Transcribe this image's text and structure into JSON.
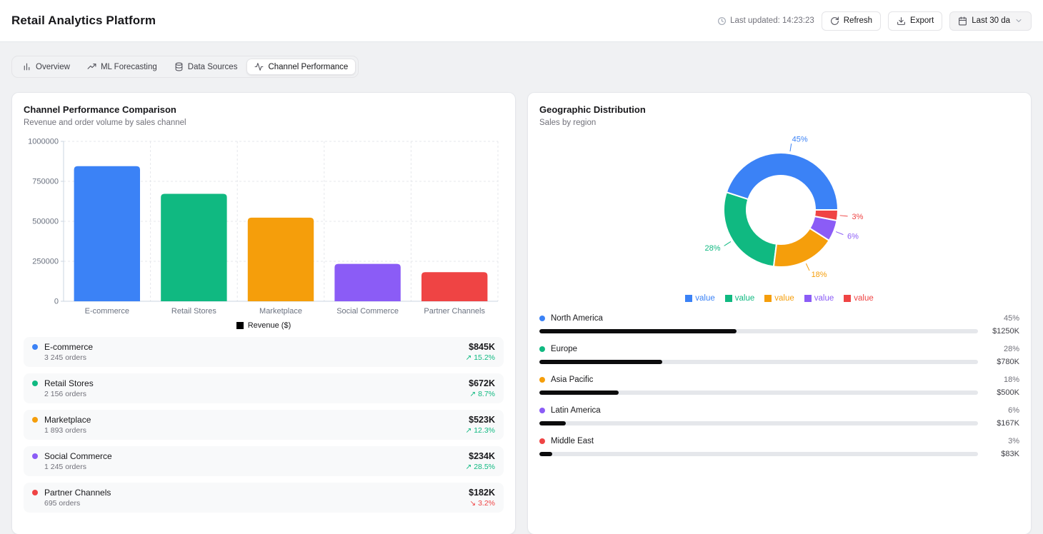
{
  "header": {
    "title": "Retail Analytics Platform",
    "last_updated": "Last updated: 14:23:23",
    "refresh_label": "Refresh",
    "export_label": "Export",
    "date_range_label": "Last 30 da",
    "icons": [
      "clock-icon",
      "refresh-icon",
      "download-icon",
      "calendar-icon",
      "chevron-down-icon"
    ]
  },
  "tabs": [
    {
      "label": "Overview",
      "icon": "bar-chart",
      "active": false
    },
    {
      "label": "ML Forecasting",
      "icon": "trending-up",
      "active": false
    },
    {
      "label": "Data Sources",
      "icon": "database",
      "active": false
    },
    {
      "label": "Channel Performance",
      "icon": "activity",
      "active": true
    }
  ],
  "channel_card": {
    "title": "Channel Performance Comparison",
    "subtitle": "Revenue and order volume by sales channel",
    "legend_label": "Revenue ($)",
    "legend_color": "#000000",
    "channels": [
      {
        "name": "E-commerce",
        "orders": "3 245 orders",
        "value": "$845K",
        "trend": "15.2%",
        "direction": "up",
        "color": "#3b82f6"
      },
      {
        "name": "Retail Stores",
        "orders": "2 156 orders",
        "value": "$672K",
        "trend": "8.7%",
        "direction": "up",
        "color": "#10b981"
      },
      {
        "name": "Marketplace",
        "orders": "1 893 orders",
        "value": "$523K",
        "trend": "12.3%",
        "direction": "up",
        "color": "#f59e0b"
      },
      {
        "name": "Social Commerce",
        "orders": "1 245 orders",
        "value": "$234K",
        "trend": "28.5%",
        "direction": "up",
        "color": "#8b5cf6"
      },
      {
        "name": "Partner Channels",
        "orders": "695 orders",
        "value": "$182K",
        "trend": "3.2%",
        "direction": "down",
        "color": "#ef4444"
      }
    ]
  },
  "geo_card": {
    "title": "Geographic Distribution",
    "subtitle": "Sales by region",
    "legend": [
      {
        "label": "value",
        "color": "#3b82f6"
      },
      {
        "label": "value",
        "color": "#10b981"
      },
      {
        "label": "value",
        "color": "#f59e0b"
      },
      {
        "label": "value",
        "color": "#8b5cf6"
      },
      {
        "label": "value",
        "color": "#ef4444"
      }
    ],
    "regions": [
      {
        "name": "North America",
        "percent": 45,
        "percent_label": "45%",
        "value": "$1250K",
        "color": "#3b82f6"
      },
      {
        "name": "Europe",
        "percent": 28,
        "percent_label": "28%",
        "value": "$780K",
        "color": "#10b981"
      },
      {
        "name": "Asia Pacific",
        "percent": 18,
        "percent_label": "18%",
        "value": "$500K",
        "color": "#f59e0b"
      },
      {
        "name": "Latin America",
        "percent": 6,
        "percent_label": "6%",
        "value": "$167K",
        "color": "#8b5cf6"
      },
      {
        "name": "Middle East",
        "percent": 3,
        "percent_label": "3%",
        "value": "$83K",
        "color": "#ef4444"
      }
    ]
  },
  "chart_data": [
    {
      "type": "bar",
      "title": "Channel Performance Comparison",
      "categories": [
        "E-commerce",
        "Retail Stores",
        "Marketplace",
        "Social Commerce",
        "Partner Channels"
      ],
      "series": [
        {
          "name": "Revenue ($)",
          "values": [
            845000,
            672000,
            523000,
            234000,
            182000
          ]
        }
      ],
      "colors": [
        "#3b82f6",
        "#10b981",
        "#f59e0b",
        "#8b5cf6",
        "#ef4444"
      ],
      "xlabel": "",
      "ylabel": "",
      "ylim": [
        0,
        1000000
      ],
      "yticks": [
        0,
        250000,
        500000,
        750000,
        1000000
      ],
      "grid": true,
      "legend_position": "bottom"
    },
    {
      "type": "pie",
      "title": "Geographic Distribution",
      "donut": true,
      "labels": [
        "North America",
        "Europe",
        "Asia Pacific",
        "Latin America",
        "Middle East"
      ],
      "values": [
        45,
        28,
        18,
        6,
        3
      ],
      "value_labels": [
        "45%",
        "28%",
        "18%",
        "6%",
        "3%"
      ],
      "colors": [
        "#3b82f6",
        "#10b981",
        "#f59e0b",
        "#8b5cf6",
        "#ef4444"
      ],
      "legend_entries": [
        "value",
        "value",
        "value",
        "value",
        "value"
      ],
      "start_angle": 0,
      "direction": "counterclockwise",
      "legend_position": "bottom"
    }
  ]
}
